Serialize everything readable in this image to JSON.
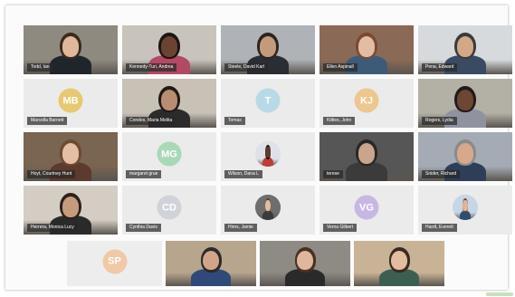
{
  "participants": [
    {
      "name": "Todd, Ian",
      "type": "video",
      "bg": "#8e8a80",
      "skin": "#e0b79a",
      "shirt": "#20252c",
      "hair": "#3a2a20"
    },
    {
      "name": "Kennedy-Turi, Andrea",
      "type": "video",
      "bg": "#c9c4bb",
      "skin": "#6b4330",
      "shirt": "#b14a63",
      "hair": "#1b1613"
    },
    {
      "name": "Steele, David Karl",
      "type": "video",
      "bg": "#afb2b6",
      "skin": "#c49a7c",
      "shirt": "#2a2d33",
      "hair": "#2b2420"
    },
    {
      "name": "Ellen Aspinall",
      "type": "video",
      "bg": "#8a6a57",
      "skin": "#e3bca4",
      "shirt": "#3d5b79",
      "hair": "#7b4a31"
    },
    {
      "name": "Pena, Edward",
      "type": "video",
      "bg": "#d7dadd",
      "skin": "#d1a888",
      "shirt": "#3a4a63",
      "hair": "#3a3a3a"
    },
    {
      "name": "Marcella Barnett",
      "type": "initials",
      "initials": "MB",
      "color": "#e8c870"
    },
    {
      "name": "Condes, Maria Melita",
      "type": "video",
      "bg": "#c8c1b6",
      "skin": "#b88d70",
      "shirt": "#2b2b2b",
      "hair": "#1e1a18"
    },
    {
      "name": "Tomas",
      "type": "initials",
      "initials": "T",
      "color": "#b9d9e6"
    },
    {
      "name": "Kittles, John",
      "type": "initials",
      "initials": "KJ",
      "color": "#ecc78f"
    },
    {
      "name": "Rogers, Lydia",
      "type": "video",
      "bg": "#b3b0a5",
      "skin": "#6d4634",
      "shirt": "#8f93a0",
      "hair": "#221a16"
    },
    {
      "name": "Hoyt, Courtney Hunt",
      "type": "video",
      "bg": "#7a6452",
      "skin": "#e4bfa5",
      "shirt": "#5d3a2e",
      "hair": "#6e4a30"
    },
    {
      "name": "margaret grue",
      "type": "initials",
      "initials": "MG",
      "color": "#a9d8b7"
    },
    {
      "name": "Wilson, Dana L",
      "type": "photo",
      "skin": "#5e3b2c",
      "shirt": "#c23a3a",
      "hair": "#1a1412",
      "bg": "#dde2e8"
    },
    {
      "name": "terese",
      "type": "video",
      "bg": "#565656",
      "skin": "#c9a58d",
      "shirt": "#3b3b3b",
      "hair": "#2a2624"
    },
    {
      "name": "Snider, Richard",
      "type": "video",
      "bg": "#a4abb4",
      "skin": "#d6a98d",
      "shirt": "#2e3d58",
      "hair": "#8a8a8a"
    },
    {
      "name": "Herrera, Monica Lucy",
      "type": "video",
      "bg": "#d4cdc4",
      "skin": "#c59b7e",
      "shirt": "#2a2a2a",
      "hair": "#2c211b"
    },
    {
      "name": "Cynthia Davis",
      "type": "initials",
      "initials": "CD",
      "color": "#cfd3d8"
    },
    {
      "name": "Hirns, Jamie",
      "type": "photo",
      "skin": "#e3bda2",
      "shirt": "#3a3a3a",
      "hair": "#5a3c28",
      "bg": "#6e6e6e"
    },
    {
      "name": "Verna Gilbert",
      "type": "initials",
      "initials": "VG",
      "color": "#c8b7e3"
    },
    {
      "name": "Hardt, Everett",
      "type": "photo",
      "skin": "#e0b59a",
      "shirt": "#2f4d73",
      "hair": "#6b4a30",
      "bg": "#c7d6e6"
    }
  ],
  "bottom_row": [
    {
      "name": "",
      "type": "initials",
      "initials": "SP",
      "color": "#f0c9a6"
    },
    {
      "name": "",
      "type": "video",
      "bg": "#b8a58e",
      "skin": "#d2a58a",
      "shirt": "#2f4a7a",
      "hair": "#2a2a2a"
    },
    {
      "name": "",
      "type": "video",
      "bg": "#8e8a84",
      "skin": "#dfb79c",
      "shirt": "#2a2a2a",
      "hair": "#4a3020"
    },
    {
      "name": "",
      "type": "video",
      "bg": "#c9b396",
      "skin": "#e2bda0",
      "shirt": "#3c5f52",
      "hair": "#3a2a20"
    }
  ]
}
